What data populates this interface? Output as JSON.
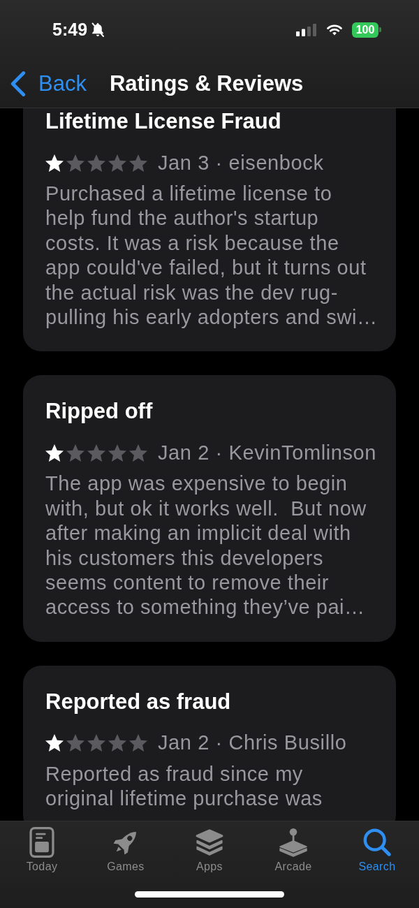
{
  "status_bar": {
    "time": "5:49",
    "battery": "100"
  },
  "nav_bar": {
    "back": "Back",
    "title": "Ratings & Reviews"
  },
  "reviews": [
    {
      "title": "Lifetime License Fraud",
      "stars": 1,
      "meta": "Jan 3 · eisenbock",
      "lines": [
        "Purchased a lifetime license to",
        "help fund the author's startup",
        "costs. It was a risk because the",
        "app could've failed, but it turns out",
        "the actual risk was the dev rug-",
        "pulling his early adopters and swi…"
      ]
    },
    {
      "title": "Ripped off",
      "stars": 1,
      "meta": "Jan 2 · KevinTomlinson",
      "lines": [
        "The app was expensive to begin",
        "with, but ok it works well.  But now",
        "after making an implicit deal with",
        "his customers this developers",
        "seems content to remove their",
        "access to something they’ve pai…"
      ]
    },
    {
      "title": "Reported as fraud",
      "stars": 1,
      "meta": "Jan 2 · Chris Busillo",
      "lines": [
        "Reported as fraud since my",
        "original lifetime purchase was"
      ]
    }
  ],
  "tab_bar": {
    "tabs": [
      {
        "label": "Today",
        "selected": false
      },
      {
        "label": "Games",
        "selected": false
      },
      {
        "label": "Apps",
        "selected": false
      },
      {
        "label": "Arcade",
        "selected": false
      },
      {
        "label": "Search",
        "selected": true
      }
    ]
  }
}
